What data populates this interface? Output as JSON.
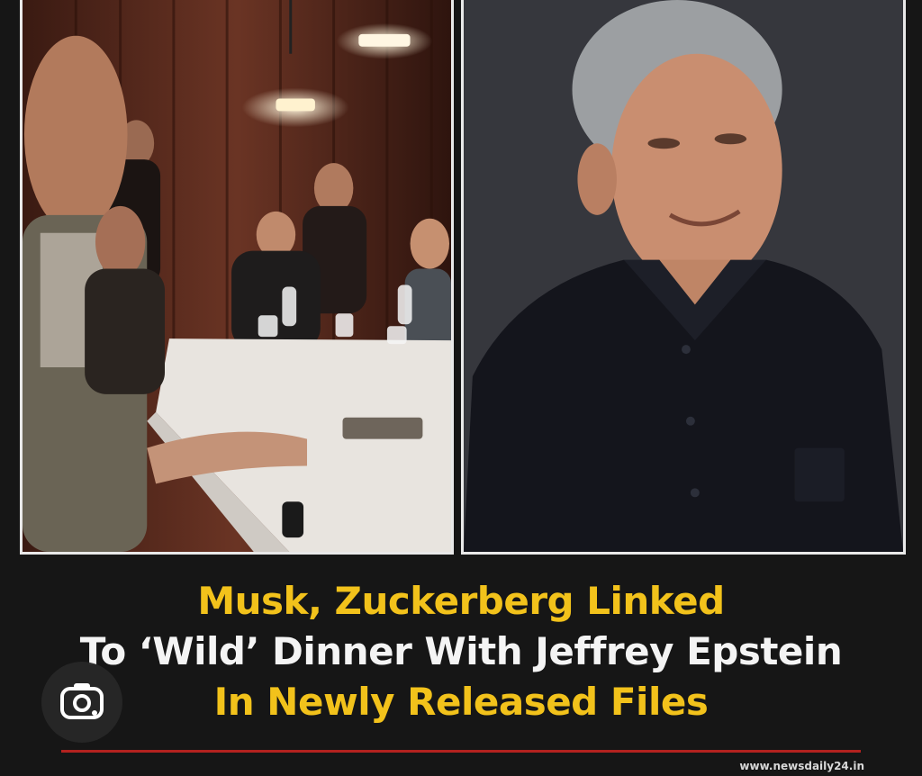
{
  "post": {
    "headline_line1": "Musk, Zuckerberg Linked",
    "headline_line2": "To ‘Wild’ Dinner With Jeffrey Epstein",
    "headline_line3": "In Newly Released Files",
    "source": "www.newsdaily24.in"
  },
  "colors": {
    "accent_yellow": "#f2c21b",
    "rule_red": "#b3221f",
    "background": "#161616"
  },
  "lens_button": {
    "icon": "camera-lens-icon"
  }
}
